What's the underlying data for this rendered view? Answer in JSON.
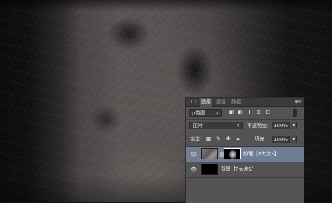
{
  "layers_panel": {
    "tabs": [
      {
        "label": "3D",
        "active": false
      },
      {
        "label": "图层",
        "active": true
      },
      {
        "label": "通道",
        "active": false
      },
      {
        "label": "路径",
        "active": false
      }
    ],
    "filter": {
      "kind_label": "ρ类型",
      "icons": [
        "image-filter-icon",
        "adjustment-filter-icon",
        "type-filter-icon",
        "shape-filter-icon",
        "smart-object-filter-icon",
        "filter-toggle-icon"
      ]
    },
    "blend_mode": "正常",
    "opacity_label": "不透明度:",
    "opacity_value": "100%",
    "lock_label": "锁定:",
    "fill_label": "填充:",
    "fill_value": "100%",
    "layers": [
      {
        "name": "纹理【P大点S】",
        "visible": true,
        "selected": true,
        "has_mask": true
      },
      {
        "name": "背景【P大点S】",
        "visible": true,
        "selected": false,
        "has_mask": false
      }
    ],
    "accent_color": "#6f7e95"
  }
}
